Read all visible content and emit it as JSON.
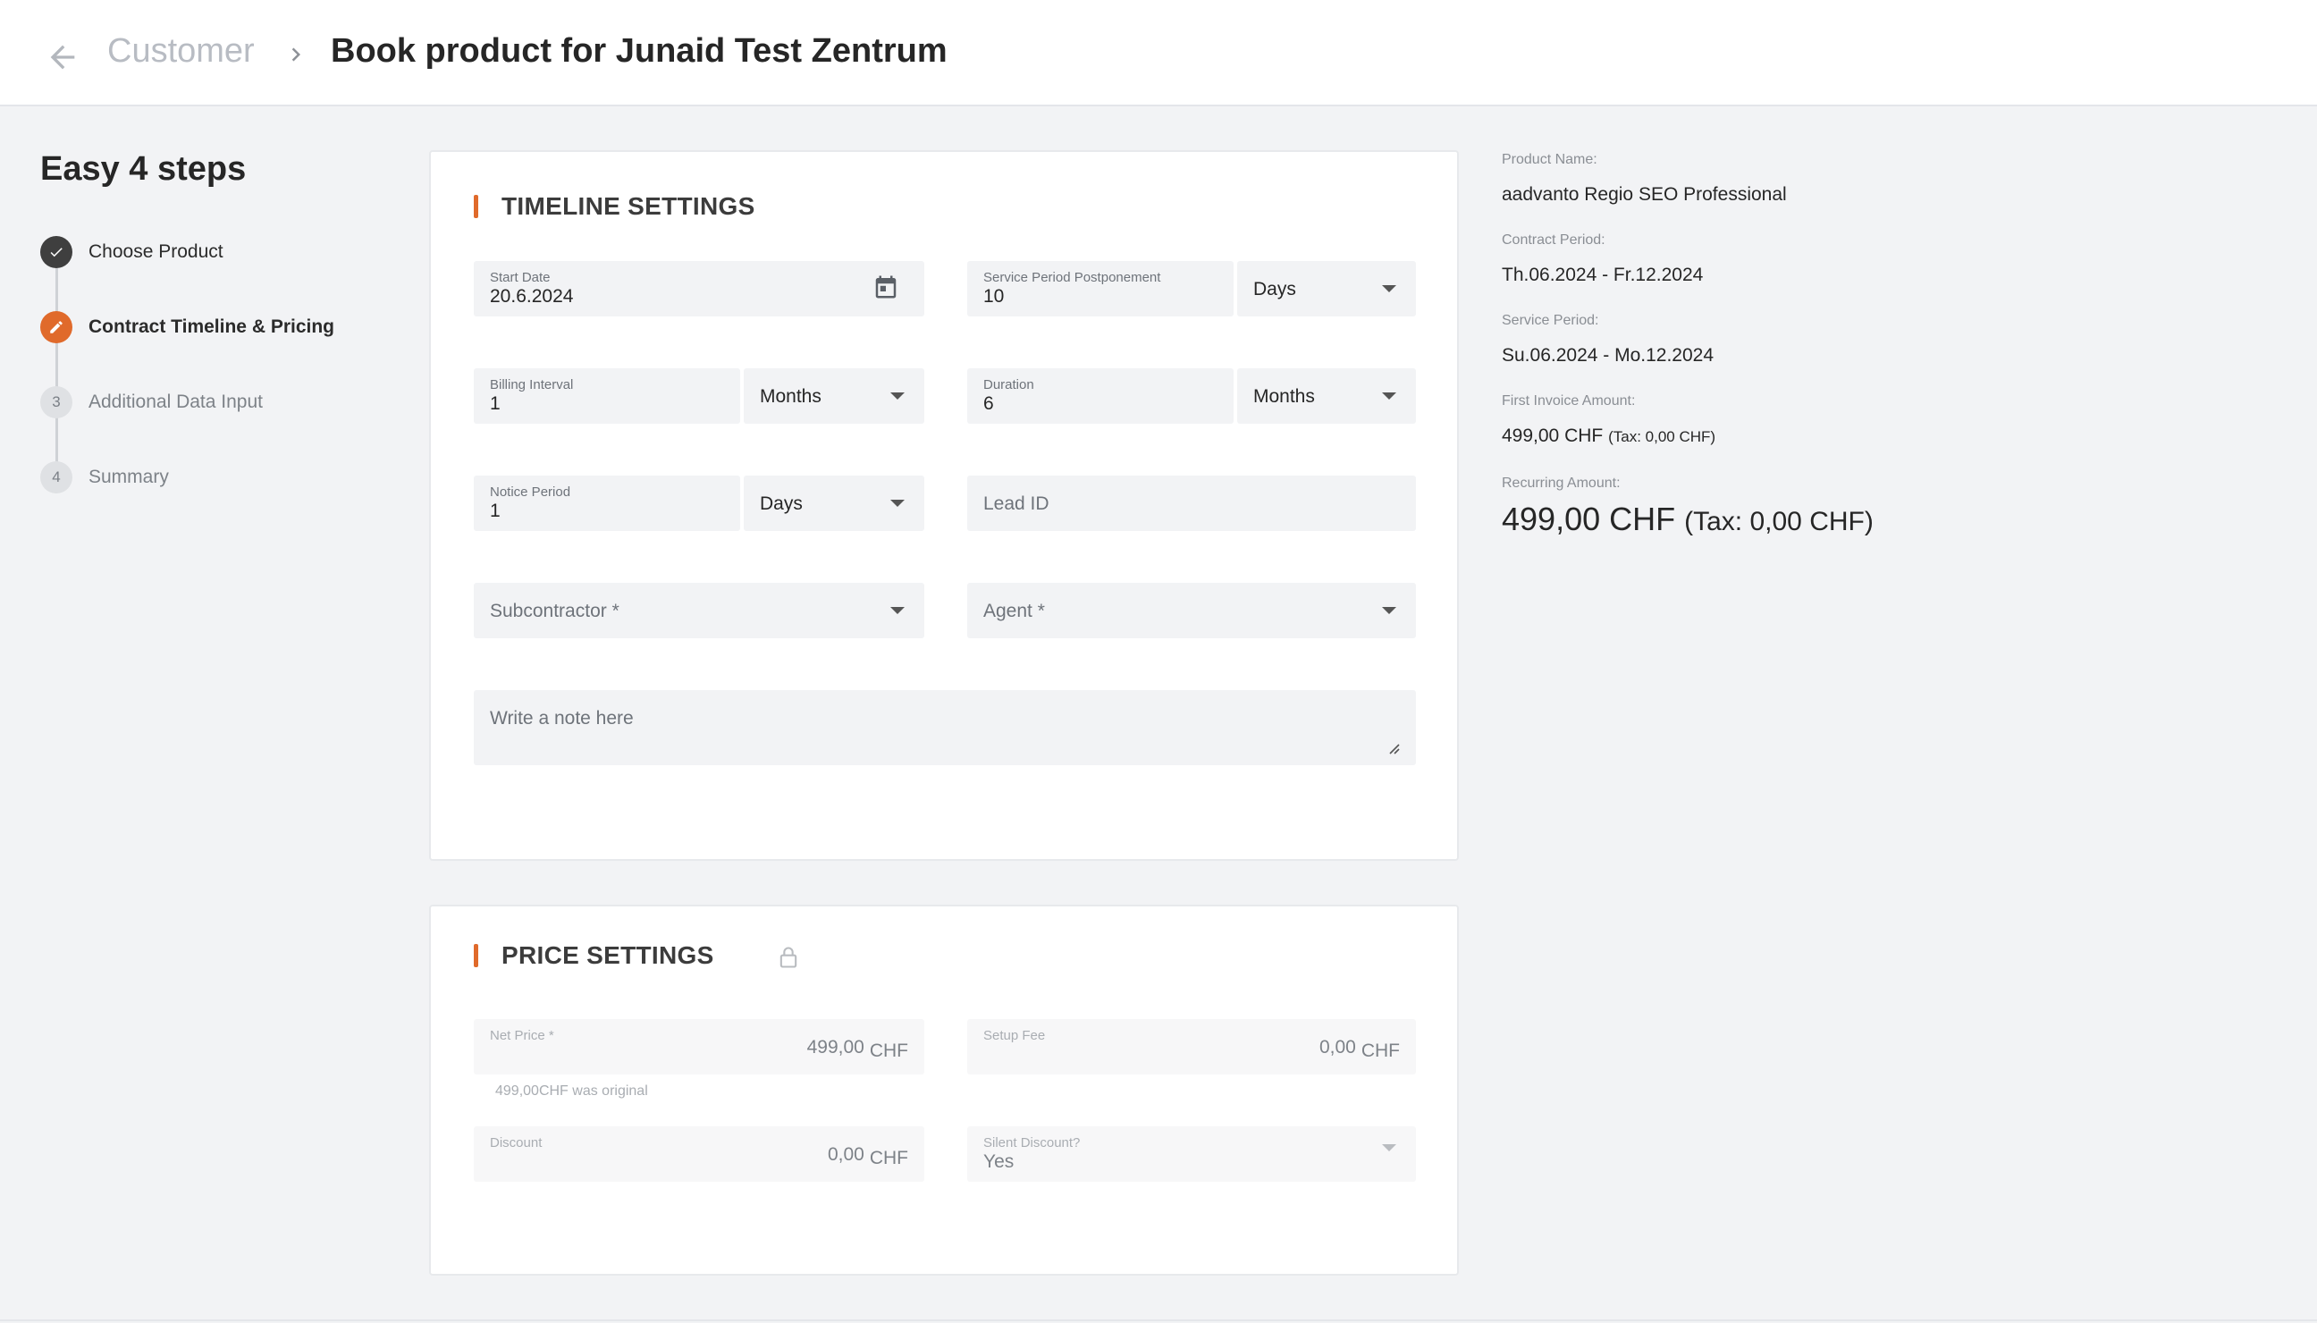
{
  "header": {
    "breadcrumb_parent": "Customer",
    "title": "Book product for Junaid Test Zentrum"
  },
  "steps": {
    "title": "Easy 4 steps",
    "items": [
      {
        "number": "1",
        "label": "Choose Product",
        "state": "done"
      },
      {
        "number": "2",
        "label": "Contract Timeline & Pricing",
        "state": "active"
      },
      {
        "number": "3",
        "label": "Additional Data Input",
        "state": "pending"
      },
      {
        "number": "4",
        "label": "Summary",
        "state": "pending"
      }
    ]
  },
  "timeline": {
    "title": "TIMELINE SETTINGS",
    "start_date": {
      "label": "Start Date",
      "value": "20.6.2024"
    },
    "service_postponement": {
      "label": "Service Period Postponement",
      "value": "10",
      "unit": "Days"
    },
    "billing_interval": {
      "label": "Billing Interval",
      "value": "1",
      "unit": "Months"
    },
    "duration": {
      "label": "Duration",
      "value": "6",
      "unit": "Months"
    },
    "notice_period": {
      "label": "Notice Period",
      "value": "1",
      "unit": "Days"
    },
    "lead_id": {
      "placeholder": "Lead ID"
    },
    "subcontractor": {
      "placeholder": "Subcontractor *"
    },
    "agent": {
      "placeholder": "Agent *"
    },
    "note": {
      "placeholder": "Write a note here"
    }
  },
  "price": {
    "title": "PRICE SETTINGS",
    "net_price": {
      "label": "Net Price *",
      "value": "499,00",
      "currency": "CHF",
      "hint": "499,00CHF was original"
    },
    "setup_fee": {
      "label": "Setup Fee",
      "value": "0,00",
      "currency": "CHF"
    },
    "discount": {
      "label": "Discount",
      "value": "0,00",
      "currency": "CHF"
    },
    "silent_discount": {
      "label": "Silent Discount?",
      "value": "Yes"
    }
  },
  "summary": {
    "product_name_label": "Product Name:",
    "product_name": "aadvanto Regio SEO Professional",
    "contract_period_label": "Contract Period:",
    "contract_period": "Th.06.2024 - Fr.12.2024",
    "service_period_label": "Service Period:",
    "service_period": "Su.06.2024 - Mo.12.2024",
    "first_invoice_label": "First Invoice Amount:",
    "first_invoice_amount": "499,00 CHF",
    "first_invoice_tax": "(Tax: 0,00 CHF)",
    "recurring_label": "Recurring Amount:",
    "recurring_amount": "499,00 CHF",
    "recurring_tax": "(Tax: 0,00 CHF)"
  },
  "colors": {
    "accent": "#e06a2b",
    "done": "#3f3f3f",
    "background": "#f2f3f5"
  }
}
